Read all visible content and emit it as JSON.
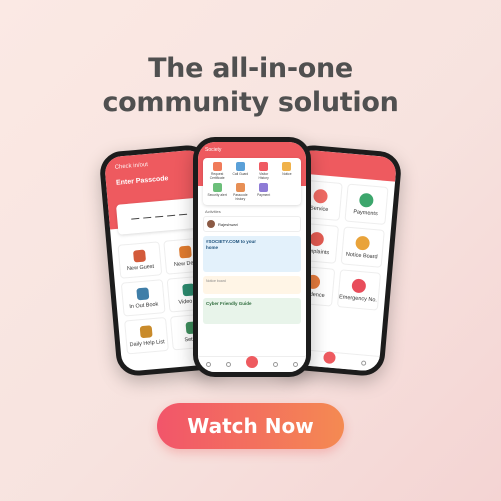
{
  "headline": {
    "line1": "The all-in-one",
    "line2": "community solution"
  },
  "cta": {
    "label": "Watch Now"
  },
  "colors": {
    "brand": "#ee5a5f",
    "text": "#505050",
    "cta_start": "#f2556a",
    "cta_end": "#f48a52"
  },
  "left_phone": {
    "header_small": "Check in/out",
    "title": "Enter Passcode",
    "tiles": [
      {
        "label": "New Guest",
        "color": "#d35a3a"
      },
      {
        "label": "New Deliv",
        "color": "#e07b2f"
      },
      {
        "label": "In Out Book",
        "color": "#3f7ea8"
      },
      {
        "label": "Video Ca",
        "color": "#2c8a6e"
      },
      {
        "label": "Daily Help List",
        "color": "#c98b2b"
      },
      {
        "label": "Setting",
        "color": "#3e8e5d"
      }
    ]
  },
  "center_phone": {
    "header_small": "Society",
    "quick_actions": [
      {
        "label": "Request Certificate",
        "color": "#f07b5a"
      },
      {
        "label": "Call Guard",
        "color": "#5aa0d8"
      },
      {
        "label": "Visitor History",
        "color": "#ef5a62"
      },
      {
        "label": "Notice",
        "color": "#f0b24a"
      },
      {
        "label": "Security alert",
        "color": "#6cbf7a"
      },
      {
        "label": "Passcode history",
        "color": "#e78f55"
      },
      {
        "label": "Payment",
        "color": "#8e7bd6"
      },
      {
        "label": "",
        "color": "#ffffff"
      }
    ],
    "section_title": "Activities",
    "visitor_name": "Rajeshwari",
    "banner_text": "#SOCIETY.COM to your home",
    "notice_text": "Notice board",
    "banner2_text": "Cyber Friendly Guide"
  },
  "right_phone": {
    "tiles": [
      {
        "label": "Service",
        "color": "#ef6a63"
      },
      {
        "label": "Payments",
        "color": "#3ca66c"
      },
      {
        "label": "Complaints",
        "color": "#e45b52"
      },
      {
        "label": "Notice Board",
        "color": "#e9a33a"
      },
      {
        "label": "Residence",
        "color": "#e67b3d"
      },
      {
        "label": "Emergency No.",
        "color": "#e84d5b"
      }
    ]
  }
}
